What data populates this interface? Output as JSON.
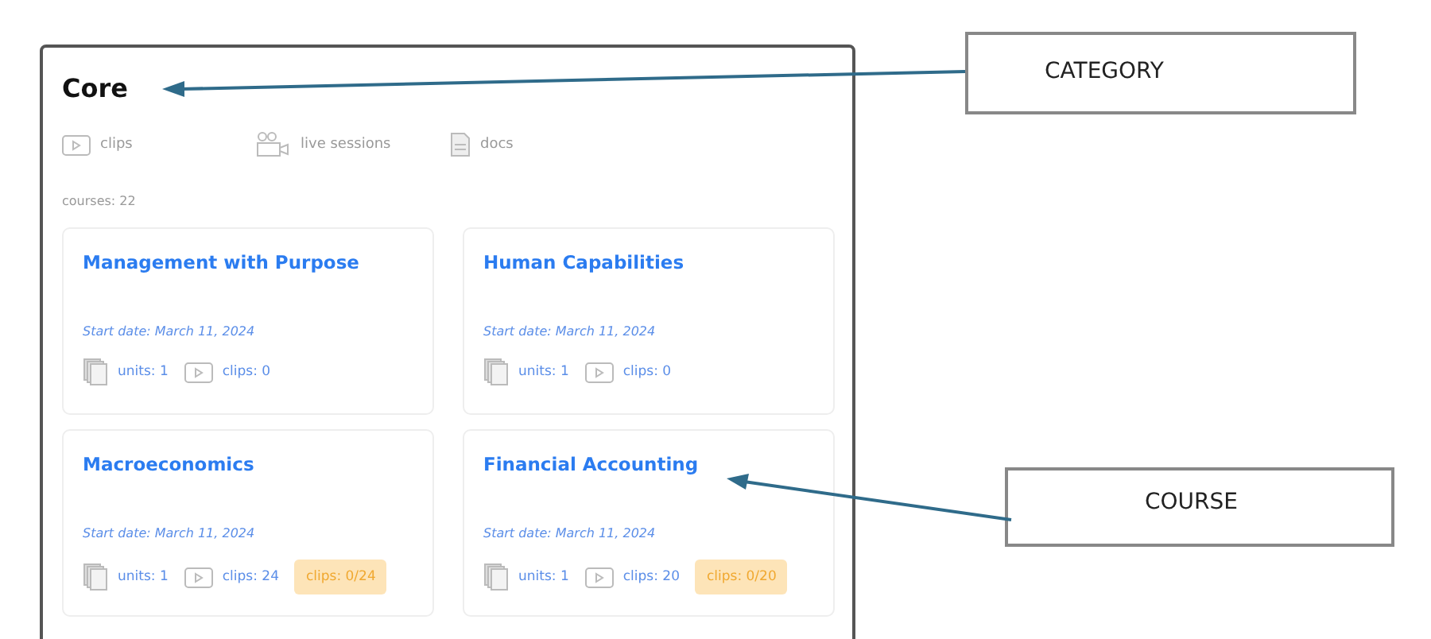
{
  "category": {
    "title": "Core",
    "media": [
      {
        "kind": "clips",
        "label": "clips"
      },
      {
        "kind": "live",
        "label": "live sessions"
      },
      {
        "kind": "docs",
        "label": "docs"
      }
    ],
    "count": "courses: 22"
  },
  "courses": [
    {
      "title": "Management with Purpose",
      "start": "Start date: March 11, 2024",
      "units": "units: 1",
      "clips": "clips: 0"
    },
    {
      "title": "Human Capabilities",
      "start": "Start date: March 11, 2024",
      "units": "units: 1",
      "clips": "clips: 0"
    },
    {
      "title": "Macroeconomics",
      "start": "Start date: March 11, 2024",
      "units": "units: 1",
      "clips": "clips: 24",
      "progress": "clips: 0/24"
    },
    {
      "title": "Financial Accounting",
      "start": "Start date: March 11, 2024",
      "units": "units: 1",
      "clips": "clips: 20",
      "progress": "clips: 0/20"
    }
  ],
  "callouts": [
    {
      "label": "CATEGORY"
    },
    {
      "label": "COURSE"
    }
  ]
}
